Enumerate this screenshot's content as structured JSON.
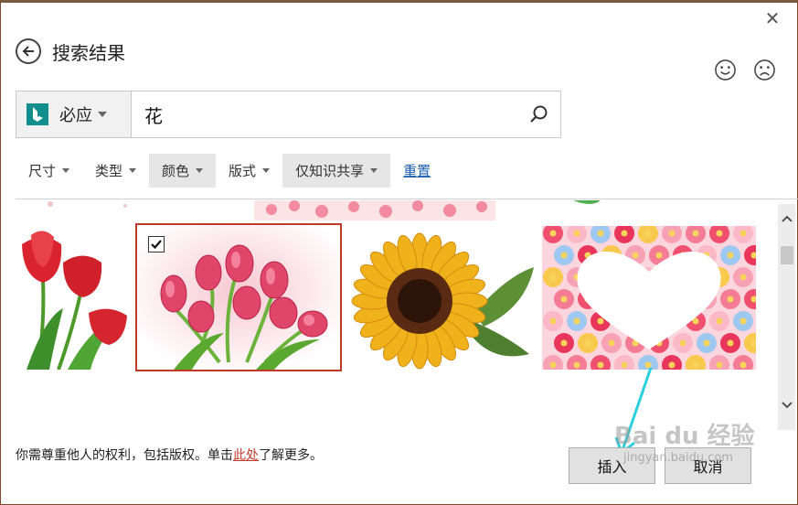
{
  "dialog": {
    "title": "搜索结果"
  },
  "search": {
    "provider_label": "必应",
    "query": "花"
  },
  "filters": [
    {
      "label": "尺寸",
      "active": false
    },
    {
      "label": "类型",
      "active": false
    },
    {
      "label": "颜色",
      "active": true
    },
    {
      "label": "版式",
      "active": false
    },
    {
      "label": "仅知识共享",
      "active": true
    }
  ],
  "reset_label": "重置",
  "results": [
    {
      "name": "red-tulips",
      "selected": false
    },
    {
      "name": "pink-tulip-bouquet",
      "selected": true
    },
    {
      "name": "sunflower",
      "selected": false
    },
    {
      "name": "flower-heart-frame",
      "selected": false
    }
  ],
  "notice": {
    "before": "你需尊重他人的权利，包括版权。单击",
    "link": "此处",
    "after": "了解更多。"
  },
  "buttons": {
    "insert": "插入",
    "cancel": "取消"
  },
  "watermark": {
    "brand": "Bai du 经验",
    "url": "jingyan.baidu.com"
  },
  "colors": {
    "bing": "#128e8e",
    "selection_border": "#c0392b",
    "link": "#1e5fb0",
    "annotation": "#2ad0dc"
  }
}
